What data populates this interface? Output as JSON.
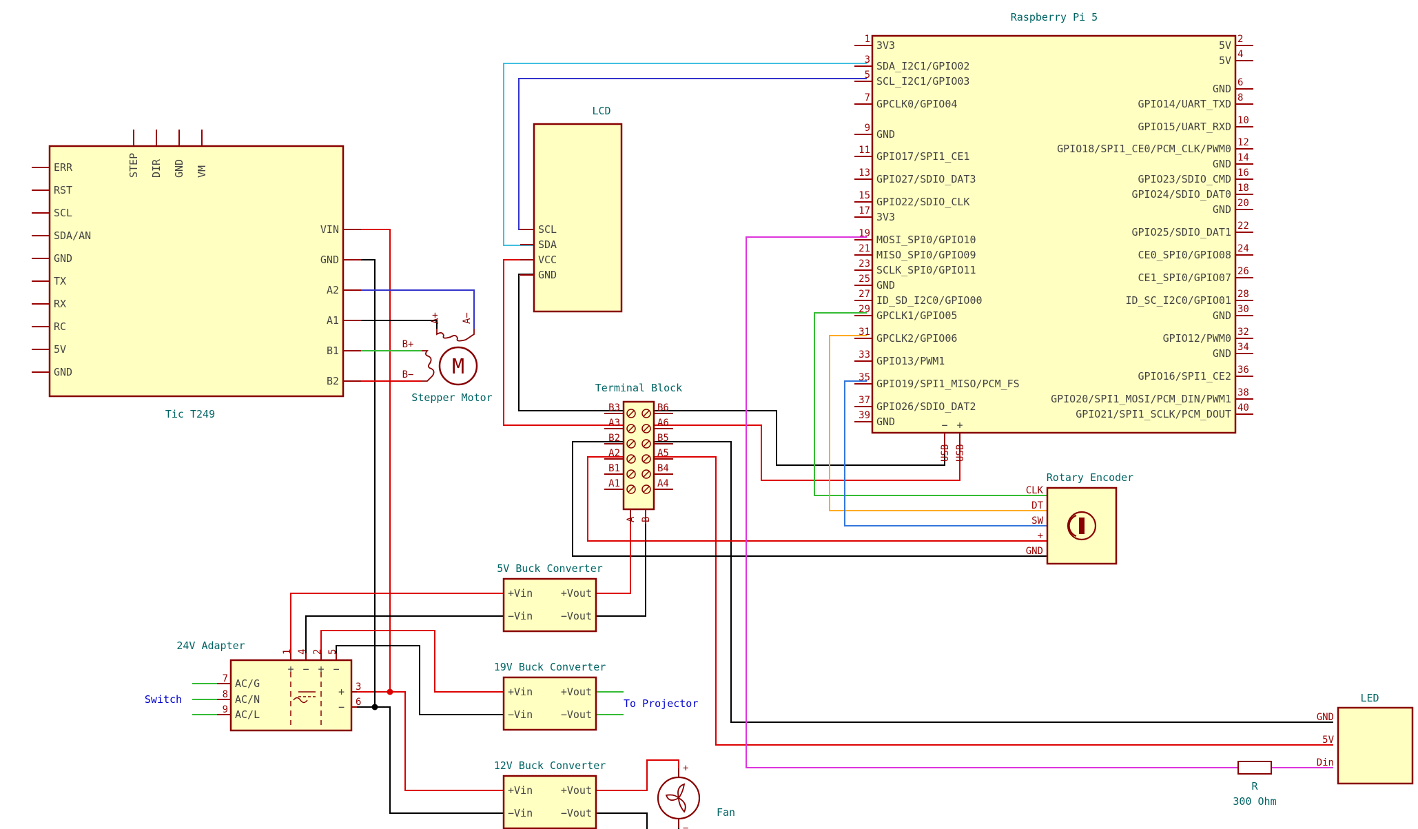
{
  "colors": {
    "component_fill": "#ffffc2",
    "component_stroke": "#880000",
    "pin_number": "#990000",
    "pin_label": "#444444",
    "ref_label": "#006464",
    "annotation": "#0000cc",
    "wire_red": "#dd0000",
    "wire_black": "#000000",
    "wire_blue": "#3333cc",
    "wire_cyan": "#40c0e0",
    "wire_green": "#33bb33",
    "wire_orange": "#ffaa22",
    "wire_sw": "#3377dd",
    "wire_magenta": "#dd33dd"
  },
  "components": {
    "tic": {
      "title": "Tic T249",
      "left_pins": [
        "ERR",
        "RST",
        "SCL",
        "SDA/AN",
        "GND",
        "TX",
        "RX",
        "RC",
        "5V",
        "GND"
      ],
      "top_pins": [
        "STEP",
        "DIR",
        "GND",
        "VM"
      ],
      "right_pins": [
        "VIN",
        "GND",
        "A2",
        "A1",
        "B1",
        "B2"
      ]
    },
    "stepper": {
      "title": "Stepper Motor",
      "symbol": "M",
      "pins": [
        "A+",
        "A−",
        "B+",
        "B−"
      ]
    },
    "lcd": {
      "title": "LCD",
      "pins": [
        "SCL",
        "SDA",
        "VCC",
        "GND"
      ]
    },
    "rpi": {
      "title": "Raspberry Pi 5",
      "left_pins": [
        {
          "num": "1",
          "label": "3V3"
        },
        {
          "num": "3",
          "label": "SDA_I2C1/GPIO02"
        },
        {
          "num": "5",
          "label": "SCL_I2C1/GPIO03"
        },
        {
          "num": "7",
          "label": "GPCLK0/GPIO04"
        },
        {
          "num": "9",
          "label": "GND"
        },
        {
          "num": "11",
          "label": "GPIO17/SPI1_CE1"
        },
        {
          "num": "13",
          "label": "GPIO27/SDIO_DAT3"
        },
        {
          "num": "15",
          "label": "GPIO22/SDIO_CLK"
        },
        {
          "num": "17",
          "label": "3V3"
        },
        {
          "num": "19",
          "label": "MOSI_SPI0/GPIO10"
        },
        {
          "num": "21",
          "label": "MISO_SPI0/GPIO09"
        },
        {
          "num": "23",
          "label": "SCLK_SPI0/GPIO11"
        },
        {
          "num": "25",
          "label": "GND"
        },
        {
          "num": "27",
          "label": "ID_SD_I2C0/GPIO00"
        },
        {
          "num": "29",
          "label": "GPCLK1/GPIO05"
        },
        {
          "num": "31",
          "label": "GPCLK2/GPIO06"
        },
        {
          "num": "33",
          "label": "GPIO13/PWM1"
        },
        {
          "num": "35",
          "label": "GPIO19/SPI1_MISO/PCM_FS"
        },
        {
          "num": "37",
          "label": "GPIO26/SDIO_DAT2"
        },
        {
          "num": "39",
          "label": "GND"
        }
      ],
      "right_pins": [
        {
          "num": "2",
          "label": "5V"
        },
        {
          "num": "4",
          "label": "5V"
        },
        {
          "num": "6",
          "label": "GND"
        },
        {
          "num": "8",
          "label": "GPIO14/UART_TXD"
        },
        {
          "num": "10",
          "label": "GPIO15/UART_RXD"
        },
        {
          "num": "12",
          "label": "GPIO18/SPI1_CE0/PCM_CLK/PWM0"
        },
        {
          "num": "14",
          "label": "GND"
        },
        {
          "num": "16",
          "label": "GPIO23/SDIO_CMD"
        },
        {
          "num": "18",
          "label": "GPIO24/SDIO_DAT0"
        },
        {
          "num": "20",
          "label": "GND"
        },
        {
          "num": "22",
          "label": "GPIO25/SDIO_DAT1"
        },
        {
          "num": "24",
          "label": "CE0_SPI0/GPIO08"
        },
        {
          "num": "26",
          "label": "CE1_SPI0/GPIO07"
        },
        {
          "num": "28",
          "label": "ID_SC_I2C0/GPIO01"
        },
        {
          "num": "30",
          "label": "GND"
        },
        {
          "num": "32",
          "label": "GPIO12/PWM0"
        },
        {
          "num": "34",
          "label": "GND"
        },
        {
          "num": "36",
          "label": "GPIO16/SPI1_CE2"
        },
        {
          "num": "38",
          "label": "GPIO20/SPI1_MOSI/PCM_DIN/PWM1"
        },
        {
          "num": "40",
          "label": "GPIO21/SPI1_SCLK/PCM_DOUT"
        }
      ],
      "usb_pins": [
        {
          "name": "USB",
          "sign": "−"
        },
        {
          "name": "USB",
          "sign": "+"
        }
      ]
    },
    "terminal": {
      "title": "Terminal Block",
      "left_labels": [
        "B3",
        "A3",
        "B2",
        "A2",
        "B1",
        "A1"
      ],
      "right_labels": [
        "B6",
        "A6",
        "B5",
        "A5",
        "B4",
        "A4"
      ],
      "bottom_labels": [
        "A",
        "B"
      ]
    },
    "encoder": {
      "title": "Rotary Encoder",
      "pins": [
        "CLK",
        "DT",
        "SW",
        "+",
        "GND"
      ]
    },
    "buck5": {
      "title": "5V Buck Converter",
      "pins": [
        "+Vin",
        "−Vin",
        "+Vout",
        "−Vout"
      ]
    },
    "buck19": {
      "title": "19V Buck Converter",
      "pins": [
        "+Vin",
        "−Vin",
        "+Vout",
        "−Vout"
      ]
    },
    "buck12": {
      "title": "12V Buck Converter",
      "pins": [
        "+Vin",
        "−Vin",
        "+Vout",
        "−Vout"
      ]
    },
    "adapter": {
      "title": "24V Adapter",
      "left_pins": [
        {
          "num": "7",
          "label": "AC/G"
        },
        {
          "num": "8",
          "label": "AC/N"
        },
        {
          "num": "9",
          "label": "AC/L"
        }
      ],
      "right_pins": [
        {
          "num": "3",
          "label": "+"
        },
        {
          "num": "6",
          "label": "−"
        }
      ],
      "top_pins": [
        {
          "num": "1",
          "label": "+"
        },
        {
          "num": "4",
          "label": "−"
        },
        {
          "num": "2",
          "label": "+"
        },
        {
          "num": "5",
          "label": "−"
        }
      ]
    },
    "fan": {
      "title": "Fan",
      "pins": [
        "+",
        "−"
      ]
    },
    "led": {
      "title": "LED",
      "pins": [
        "GND",
        "5V",
        "Din"
      ]
    },
    "resistor": {
      "ref": "R",
      "value": "300 Ohm"
    }
  },
  "annotations": {
    "switch": "Switch",
    "projector": "To Projector"
  }
}
